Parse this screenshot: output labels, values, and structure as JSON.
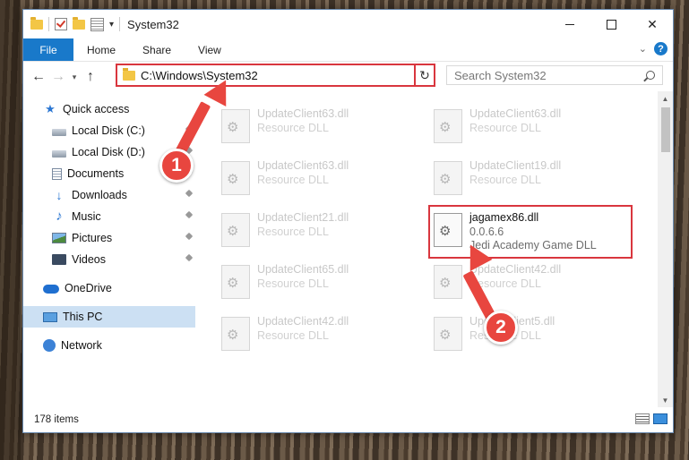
{
  "window": {
    "title": "System32"
  },
  "ribbon": {
    "tabs": [
      "File",
      "Home",
      "Share",
      "View"
    ]
  },
  "navbar": {
    "address": "C:\\Windows\\System32",
    "search_placeholder": "Search System32"
  },
  "sidebar": {
    "items": [
      {
        "label": "Quick access",
        "icon": "star-icon",
        "pinned": false
      },
      {
        "label": "Local Disk (C:)",
        "icon": "drive-icon",
        "pinned": true
      },
      {
        "label": "Local Disk (D:)",
        "icon": "drive-icon",
        "pinned": true
      },
      {
        "label": "Documents",
        "icon": "documents-icon",
        "pinned": true
      },
      {
        "label": "Downloads",
        "icon": "download-icon",
        "pinned": true
      },
      {
        "label": "Music",
        "icon": "music-icon",
        "pinned": true
      },
      {
        "label": "Pictures",
        "icon": "pictures-icon",
        "pinned": true
      },
      {
        "label": "Videos",
        "icon": "videos-icon",
        "pinned": true
      },
      {
        "label": "OneDrive",
        "icon": "cloud-icon",
        "pinned": false
      },
      {
        "label": "This PC",
        "icon": "pc-icon",
        "pinned": false,
        "selected": true
      },
      {
        "label": "Network",
        "icon": "network-icon",
        "pinned": false
      }
    ]
  },
  "files": [
    {
      "name": "UpdateClient63.dll",
      "desc": "Resource DLL"
    },
    {
      "name": "UpdateClient63.dll",
      "desc": "Resource DLL"
    },
    {
      "name": "UpdateClient63.dll",
      "desc": "Resource DLL"
    },
    {
      "name": "UpdateClient19.dll",
      "desc": "Resource DLL"
    },
    {
      "name": "UpdateClient21.dll",
      "desc": "Resource DLL"
    },
    {
      "name": "jagamex86.dll",
      "version": "0.0.6.6",
      "desc": "Jedi Academy Game DLL",
      "highlighted": true
    },
    {
      "name": "UpdateClient65.dll",
      "desc": "Resource DLL"
    },
    {
      "name": "UpdateClient42.dll",
      "desc": "Resource DLL"
    },
    {
      "name": "UpdateClient42.dll",
      "desc": "Resource DLL"
    },
    {
      "name": "UpdateClient5.dll",
      "desc": "Resource DLL"
    }
  ],
  "status": {
    "count": "178 items"
  },
  "annotations": {
    "step1": "1",
    "step2": "2"
  },
  "colors": {
    "accent": "#1979ca",
    "highlight": "#d9363e",
    "badge": "#e8463f"
  }
}
